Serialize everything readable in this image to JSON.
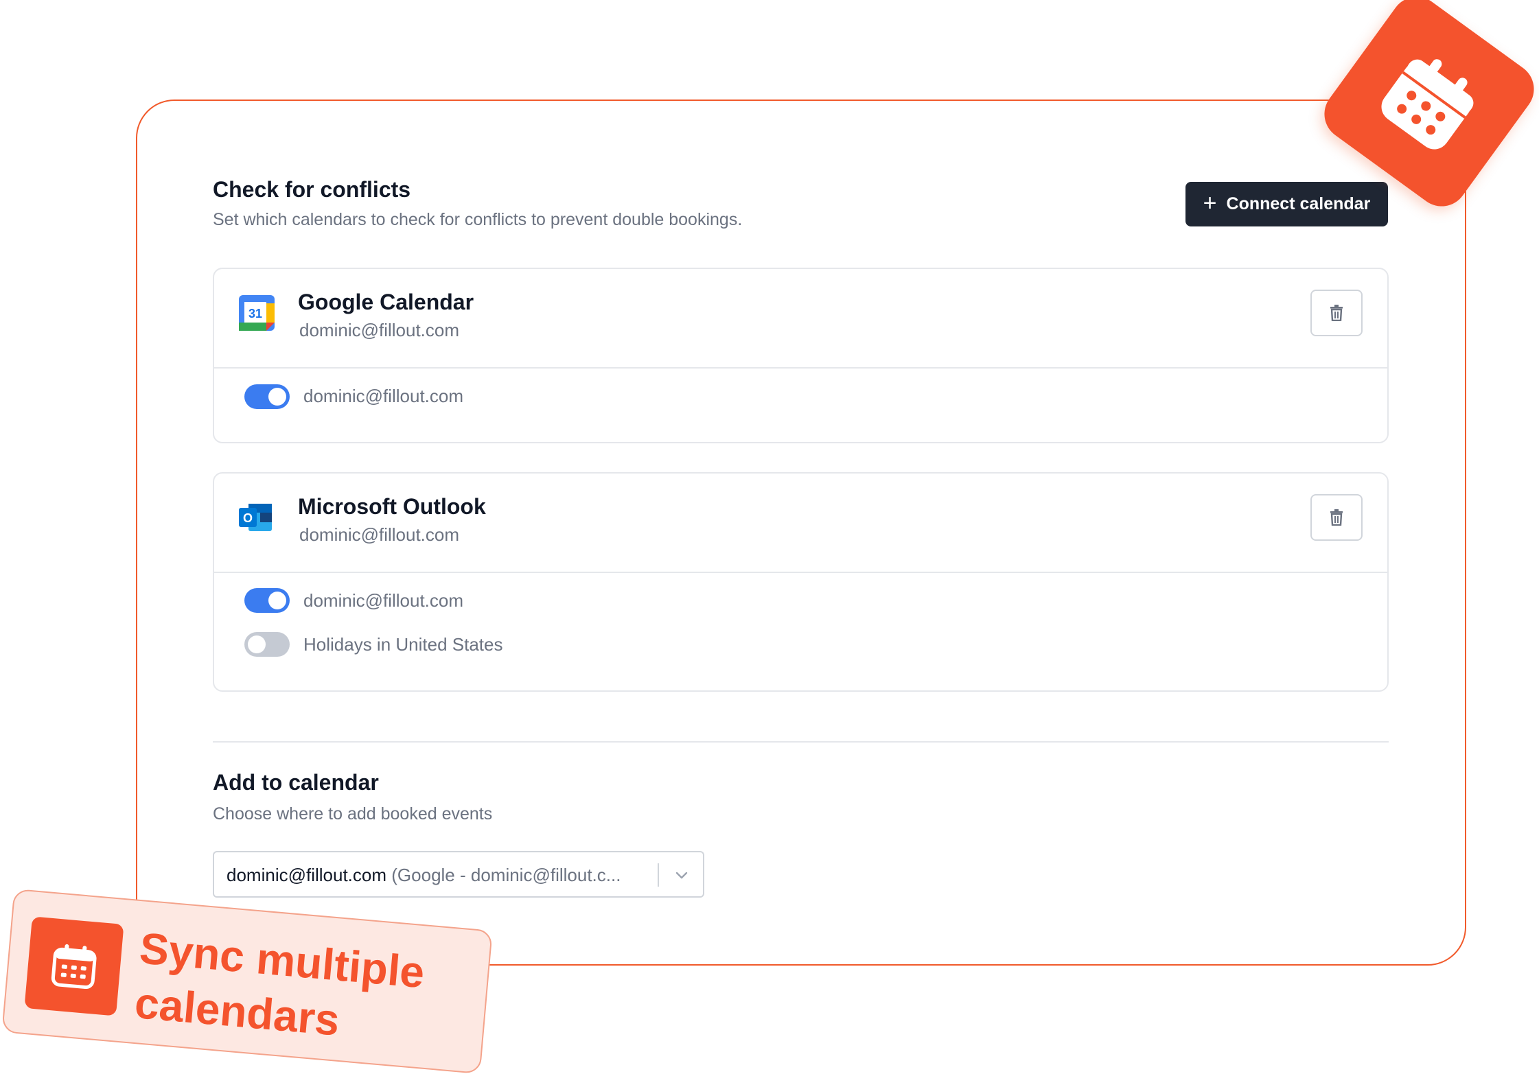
{
  "conflicts": {
    "title": "Check for conflicts",
    "subtitle": "Set which calendars to check for conflicts to prevent double bookings.",
    "connect_label": "Connect calendar"
  },
  "calendars": [
    {
      "name": "Google Calendar",
      "account": "dominic@fillout.com",
      "icon": "google-calendar-icon",
      "icon_text": "31",
      "toggles": [
        {
          "label": "dominic@fillout.com",
          "on": true
        }
      ]
    },
    {
      "name": "Microsoft Outlook",
      "account": "dominic@fillout.com",
      "icon": "outlook-icon",
      "icon_text": "O",
      "toggles": [
        {
          "label": "dominic@fillout.com",
          "on": true
        },
        {
          "label": "Holidays in United States",
          "on": false
        }
      ]
    }
  ],
  "add_to_calendar": {
    "title": "Add to calendar",
    "subtitle": "Choose where to add booked events",
    "selected_value": "dominic@fillout.com",
    "selected_hint": "(Google - dominic@fillout.c..."
  },
  "promo": {
    "line1": "Sync multiple",
    "line2": "calendars"
  },
  "colors": {
    "accent": "#f4532d",
    "toggle_on": "#3b7cf0",
    "button_dark": "#1f2633"
  }
}
